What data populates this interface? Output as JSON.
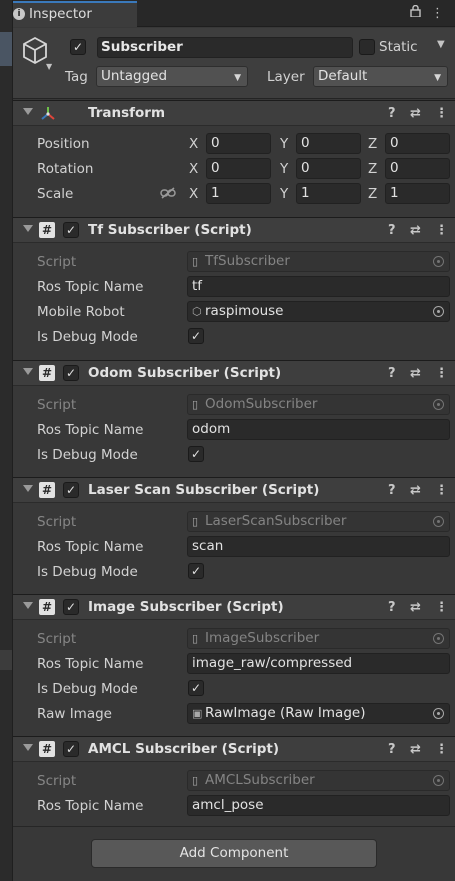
{
  "tab": {
    "title": "Inspector",
    "info_icon": "info-icon",
    "lock_icon": "lock-icon",
    "menu_icon": "kebab-menu-icon"
  },
  "gameobject": {
    "name": "Subscriber",
    "active": true,
    "static_label": "Static",
    "static": false,
    "tag_label": "Tag",
    "tag_value": "Untagged",
    "layer_label": "Layer",
    "layer_value": "Default"
  },
  "transform": {
    "title": "Transform",
    "rows": [
      {
        "label": "Position",
        "x": "0",
        "y": "0",
        "z": "0"
      },
      {
        "label": "Rotation",
        "x": "0",
        "y": "0",
        "z": "0"
      },
      {
        "label": "Scale",
        "x": "1",
        "y": "1",
        "z": "1"
      }
    ],
    "axes": [
      "X",
      "Y",
      "Z"
    ]
  },
  "components": [
    {
      "title": "Tf Subscriber (Script)",
      "script_label": "Script",
      "script": "TfSubscriber",
      "topic_label": "Ros Topic Name",
      "topic": "tf",
      "extra_label": "Mobile Robot",
      "extra_value": "raspimouse",
      "debug_label": "Is Debug Mode"
    },
    {
      "title": "Odom Subscriber (Script)",
      "script_label": "Script",
      "script": "OdomSubscriber",
      "topic_label": "Ros Topic Name",
      "topic": "odom",
      "debug_label": "Is Debug Mode"
    },
    {
      "title": "Laser Scan Subscriber (Script)",
      "script_label": "Script",
      "script": "LaserScanSubscriber",
      "topic_label": "Ros Topic Name",
      "topic": "scan",
      "debug_label": "Is Debug Mode"
    },
    {
      "title": "Image Subscriber (Script)",
      "script_label": "Script",
      "script": "ImageSubscriber",
      "topic_label": "Ros Topic Name",
      "topic": "image_raw/compressed",
      "debug_label": "Is Debug Mode",
      "extra_label": "Raw Image",
      "extra_value": "RawImage (Raw Image)"
    },
    {
      "title": "AMCL Subscriber (Script)",
      "script_label": "Script",
      "script": "AMCLSubscriber",
      "topic_label": "Ros Topic Name",
      "topic": "amcl_pose"
    }
  ],
  "add_component_label": "Add Component",
  "colors": {
    "accent": "#3a79bb",
    "panel_bg": "#383838",
    "field_bg": "#2a2a2a"
  }
}
